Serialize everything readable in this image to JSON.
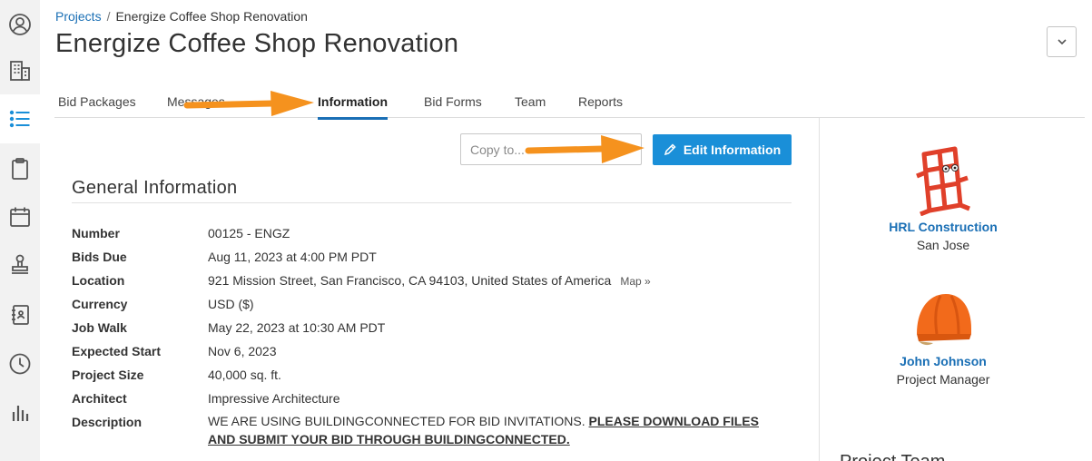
{
  "breadcrumb": {
    "root": "Projects",
    "separator": "/",
    "current": "Energize Coffee Shop Renovation"
  },
  "page_title": "Energize Coffee Shop Renovation",
  "rail": {
    "items": [
      {
        "icon": "user-circle-icon"
      },
      {
        "icon": "building-icon"
      },
      {
        "icon": "list-icon",
        "active": true
      },
      {
        "icon": "clipboard-icon"
      },
      {
        "icon": "calendar-icon"
      },
      {
        "icon": "stamp-icon"
      },
      {
        "icon": "address-book-icon"
      },
      {
        "icon": "clock-icon"
      },
      {
        "icon": "bar-chart-icon"
      }
    ]
  },
  "tabs": [
    {
      "label": "Bid Packages"
    },
    {
      "label": "Messages"
    },
    {
      "label": "Information",
      "active": true
    },
    {
      "label": "Bid Forms"
    },
    {
      "label": "Team"
    },
    {
      "label": "Reports"
    }
  ],
  "actions": {
    "copy_placeholder": "Copy to...",
    "edit_label": "Edit Information"
  },
  "general": {
    "title": "General Information",
    "rows": [
      {
        "label": "Number",
        "value": "00125 - ENGZ"
      },
      {
        "label": "Bids Due",
        "value": "Aug 11, 2023 at 4:00 PM PDT"
      },
      {
        "label": "Location",
        "value": "921 Mission Street, San Francisco, CA 94103, United States of America",
        "link": "Map »"
      },
      {
        "label": "Currency",
        "value": "USD ($)"
      },
      {
        "label": "Job Walk",
        "value": "May 22, 2023 at 10:30 AM PDT"
      },
      {
        "label": "Expected Start",
        "value": "Nov 6, 2023"
      },
      {
        "label": "Project Size",
        "value": "40,000 sq. ft."
      },
      {
        "label": "Architect",
        "value": "Impressive Architecture"
      }
    ],
    "description": {
      "label": "Description",
      "plain": "WE ARE USING BUILDINGCONNECTED FOR BID INVITATIONS. ",
      "bold": "PLEASE DOWNLOAD FILES AND SUBMIT YOUR BID THROUGH BUILDINGCONNECTED."
    }
  },
  "company": {
    "name": "HRL Construction",
    "location": "San Jose"
  },
  "manager": {
    "name": "John Johnson",
    "role": "Project Manager"
  },
  "team_heading": "Project Team",
  "colors": {
    "accent": "#1a8fd8",
    "link": "#1a6fb5",
    "annotation_arrow": "#f5921e",
    "logo_red": "#e0402a",
    "helmet_orange": "#f26a1b"
  }
}
